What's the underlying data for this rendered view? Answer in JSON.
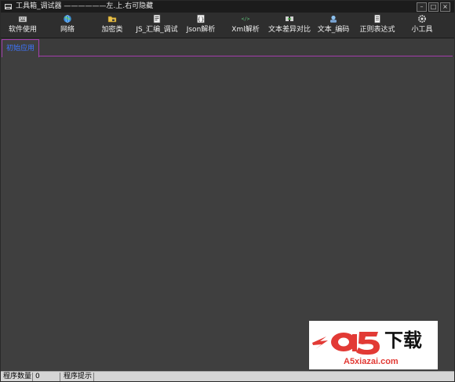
{
  "window": {
    "title": "工具箱_调试器 ——————左.上.右可隐藏",
    "minimize_label": "–",
    "maximize_label": "□",
    "close_label": "×"
  },
  "toolbar": {
    "items": [
      {
        "label": "软件使用",
        "icon": "keyboard-icon"
      },
      {
        "label": "网络",
        "icon": "globe-icon"
      },
      {
        "label": "加密类",
        "icon": "folder-lock-icon"
      },
      {
        "label": "JS_汇编_调试",
        "icon": "script-icon"
      },
      {
        "label": "Json解析",
        "icon": "braces-icon"
      },
      {
        "label": "Xml解析",
        "icon": "xml-icon"
      },
      {
        "label": "文本差异对比",
        "icon": "compare-icon"
      },
      {
        "label": "文本_编码",
        "icon": "encoding-icon"
      },
      {
        "label": "正则表达式",
        "icon": "document-icon"
      },
      {
        "label": "小工具",
        "icon": "gear-icon"
      }
    ]
  },
  "tabs": [
    {
      "label": "初始应用",
      "active": true
    }
  ],
  "watermark": {
    "brand_text": "下载",
    "domain_text": "A5xiazai.com"
  },
  "statusbar": {
    "count_label": "程序数量",
    "count_value": "0",
    "hint_label": "程序提示"
  },
  "colors": {
    "tab_accent": "#a43fae",
    "tab_text": "#3f74ff",
    "workspace_bg": "#3f3f3f",
    "titlebar_bg": "#1c1c1c",
    "watermark_red": "#e23a35"
  }
}
